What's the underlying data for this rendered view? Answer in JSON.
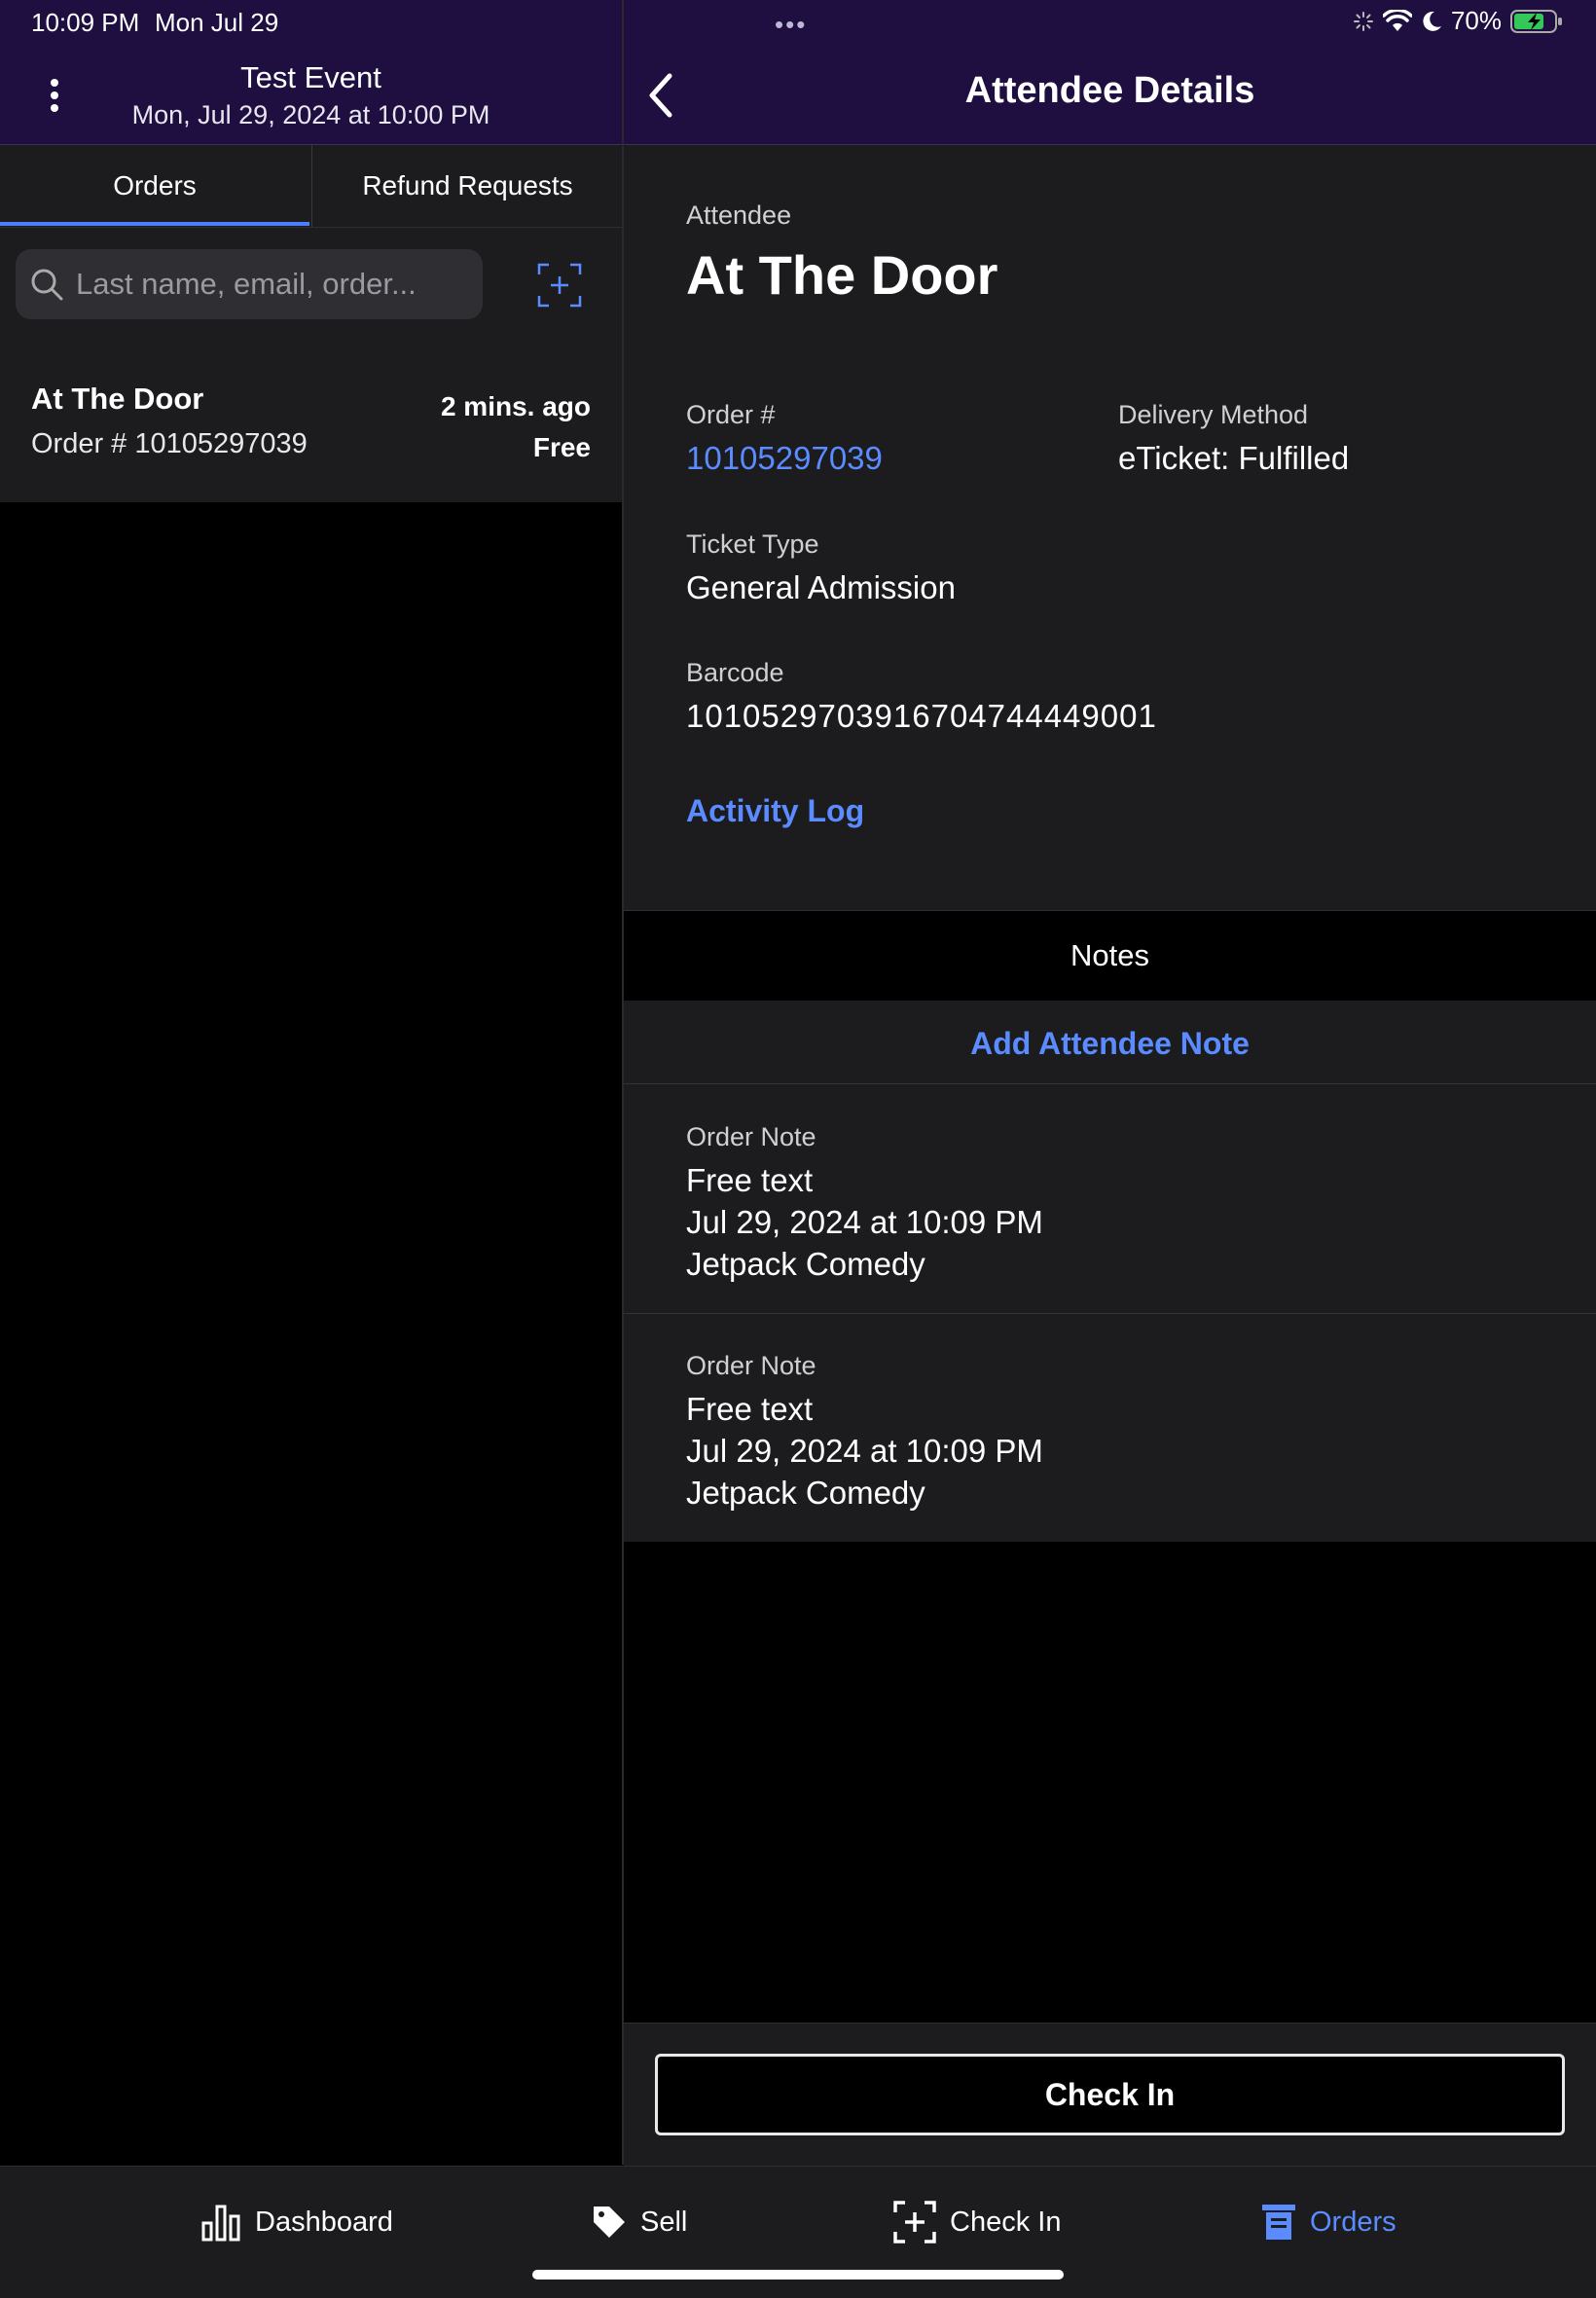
{
  "status_bar": {
    "time": "10:09 PM",
    "date": "Mon Jul 29",
    "multitask": "•••",
    "battery": "70%"
  },
  "event": {
    "title": "Test Event",
    "date": "Mon, Jul 29, 2024 at 10:00 PM"
  },
  "tabs": [
    {
      "label": "Orders",
      "selected": true
    },
    {
      "label": "Refund Requests",
      "selected": false
    }
  ],
  "search": {
    "placeholder": "Last name, email, order..."
  },
  "orders_list": [
    {
      "name": "At The Door",
      "order": "Order # 10105297039",
      "time": "2 mins. ago",
      "price": "Free"
    }
  ],
  "detail_header": {
    "title": "Attendee Details"
  },
  "attendee": {
    "label": "Attendee",
    "name": "At The Door",
    "order_label": "Order #",
    "order_number": "10105297039",
    "delivery_label": "Delivery Method",
    "delivery_value": "eTicket: Fulfilled",
    "ticket_type_label": "Ticket Type",
    "ticket_type_value": "General Admission",
    "barcode_label": "Barcode",
    "barcode_value": "1010529703916704744449001",
    "activity_log": "Activity Log"
  },
  "notes": {
    "header": "Notes",
    "add_label": "Add Attendee Note",
    "items": [
      {
        "label": "Order Note",
        "text": "Free text",
        "date": "Jul 29, 2024 at 10:09 PM",
        "author": "Jetpack Comedy"
      },
      {
        "label": "Order Note",
        "text": "Free text",
        "date": "Jul 29, 2024 at 10:09 PM",
        "author": "Jetpack Comedy"
      }
    ]
  },
  "check_in_button": "Check In",
  "tabbar": [
    {
      "label": "Dashboard",
      "icon": "bar-chart-icon",
      "active": false
    },
    {
      "label": "Sell",
      "icon": "tag-icon",
      "active": false
    },
    {
      "label": "Check In",
      "icon": "scan-plus-icon",
      "active": false
    },
    {
      "label": "Orders",
      "icon": "orders-icon",
      "active": true
    }
  ],
  "colors": {
    "header_bg": "#1e0f40",
    "accent": "#5b8cff",
    "panel_bg": "#1c1c1f",
    "background": "#000000"
  }
}
